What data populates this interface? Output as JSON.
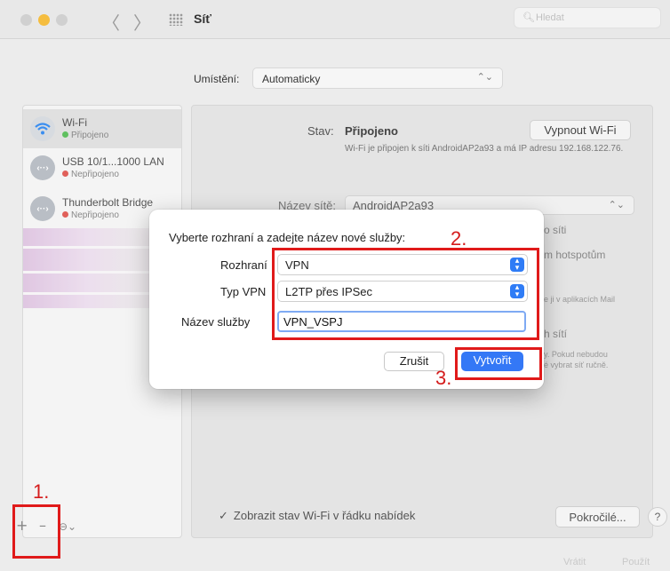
{
  "window": {
    "title": "Síť",
    "search_placeholder": "Hledat",
    "nav_back": "〈",
    "nav_forward": "〉"
  },
  "location": {
    "label": "Umístění:",
    "value": "Automaticky",
    "arrows": "⌃⌄"
  },
  "sidebar": {
    "items": [
      {
        "name": "Wi-Fi",
        "status": "Připojeno",
        "status_color": "#5fc05f",
        "icon": "wifi-icon"
      },
      {
        "name": "USB 10/1...1000 LAN",
        "status": "Nepřipojeno",
        "status_color": "#e0605a",
        "icon": "ethernet-icon"
      },
      {
        "name": "Thunderbolt Bridge",
        "status": "Nepřipojeno",
        "status_color": "#e0605a",
        "icon": "ethernet-icon"
      }
    ],
    "toolbar": {
      "add": "+",
      "remove": "–",
      "more": "⊖⌄"
    }
  },
  "main": {
    "status_label": "Stav:",
    "status_value": "Připojeno",
    "wifi_off_button": "Vypnout Wi-Fi",
    "status_description": "Wi-Fi je připojen k síti AndroidAP2a93 a má IP adresu 192.168.122.76.",
    "network_name_label": "Název sítě:",
    "network_name_value": "AndroidAP2a93",
    "side_text_1": "o síti",
    "side_text_2": "m hotspotům",
    "side_text_3": "e ji v aplikacích Mail",
    "side_text_4": "h sítí",
    "side_text_5": "y. Pokud nebudou",
    "side_text_6": "é vybrat síť ručně.",
    "show_wifi_label": "Zobrazit stav Wi-Fi v řádku nabídek",
    "show_wifi_check": "✓",
    "advanced_button": "Pokročilé...",
    "help_button": "?",
    "footer_revert": "Vrátit",
    "footer_apply": "Použít"
  },
  "dialog": {
    "title": "Vyberte rozhraní a zadejte název nové služby:",
    "interface_label": "Rozhraní",
    "interface_value": "VPN",
    "vpn_type_label": "Typ VPN",
    "vpn_type_value": "L2TP přes IPSec",
    "service_name_label": "Název služby",
    "service_name_value": "VPN_VSPJ",
    "cancel_button": "Zrušit",
    "create_button": "Vytvořit",
    "stepper": "⌃⌄"
  },
  "annotations": {
    "step1": "1.",
    "step2": "2.",
    "step3": "3.",
    "color": "#e01a1a"
  }
}
